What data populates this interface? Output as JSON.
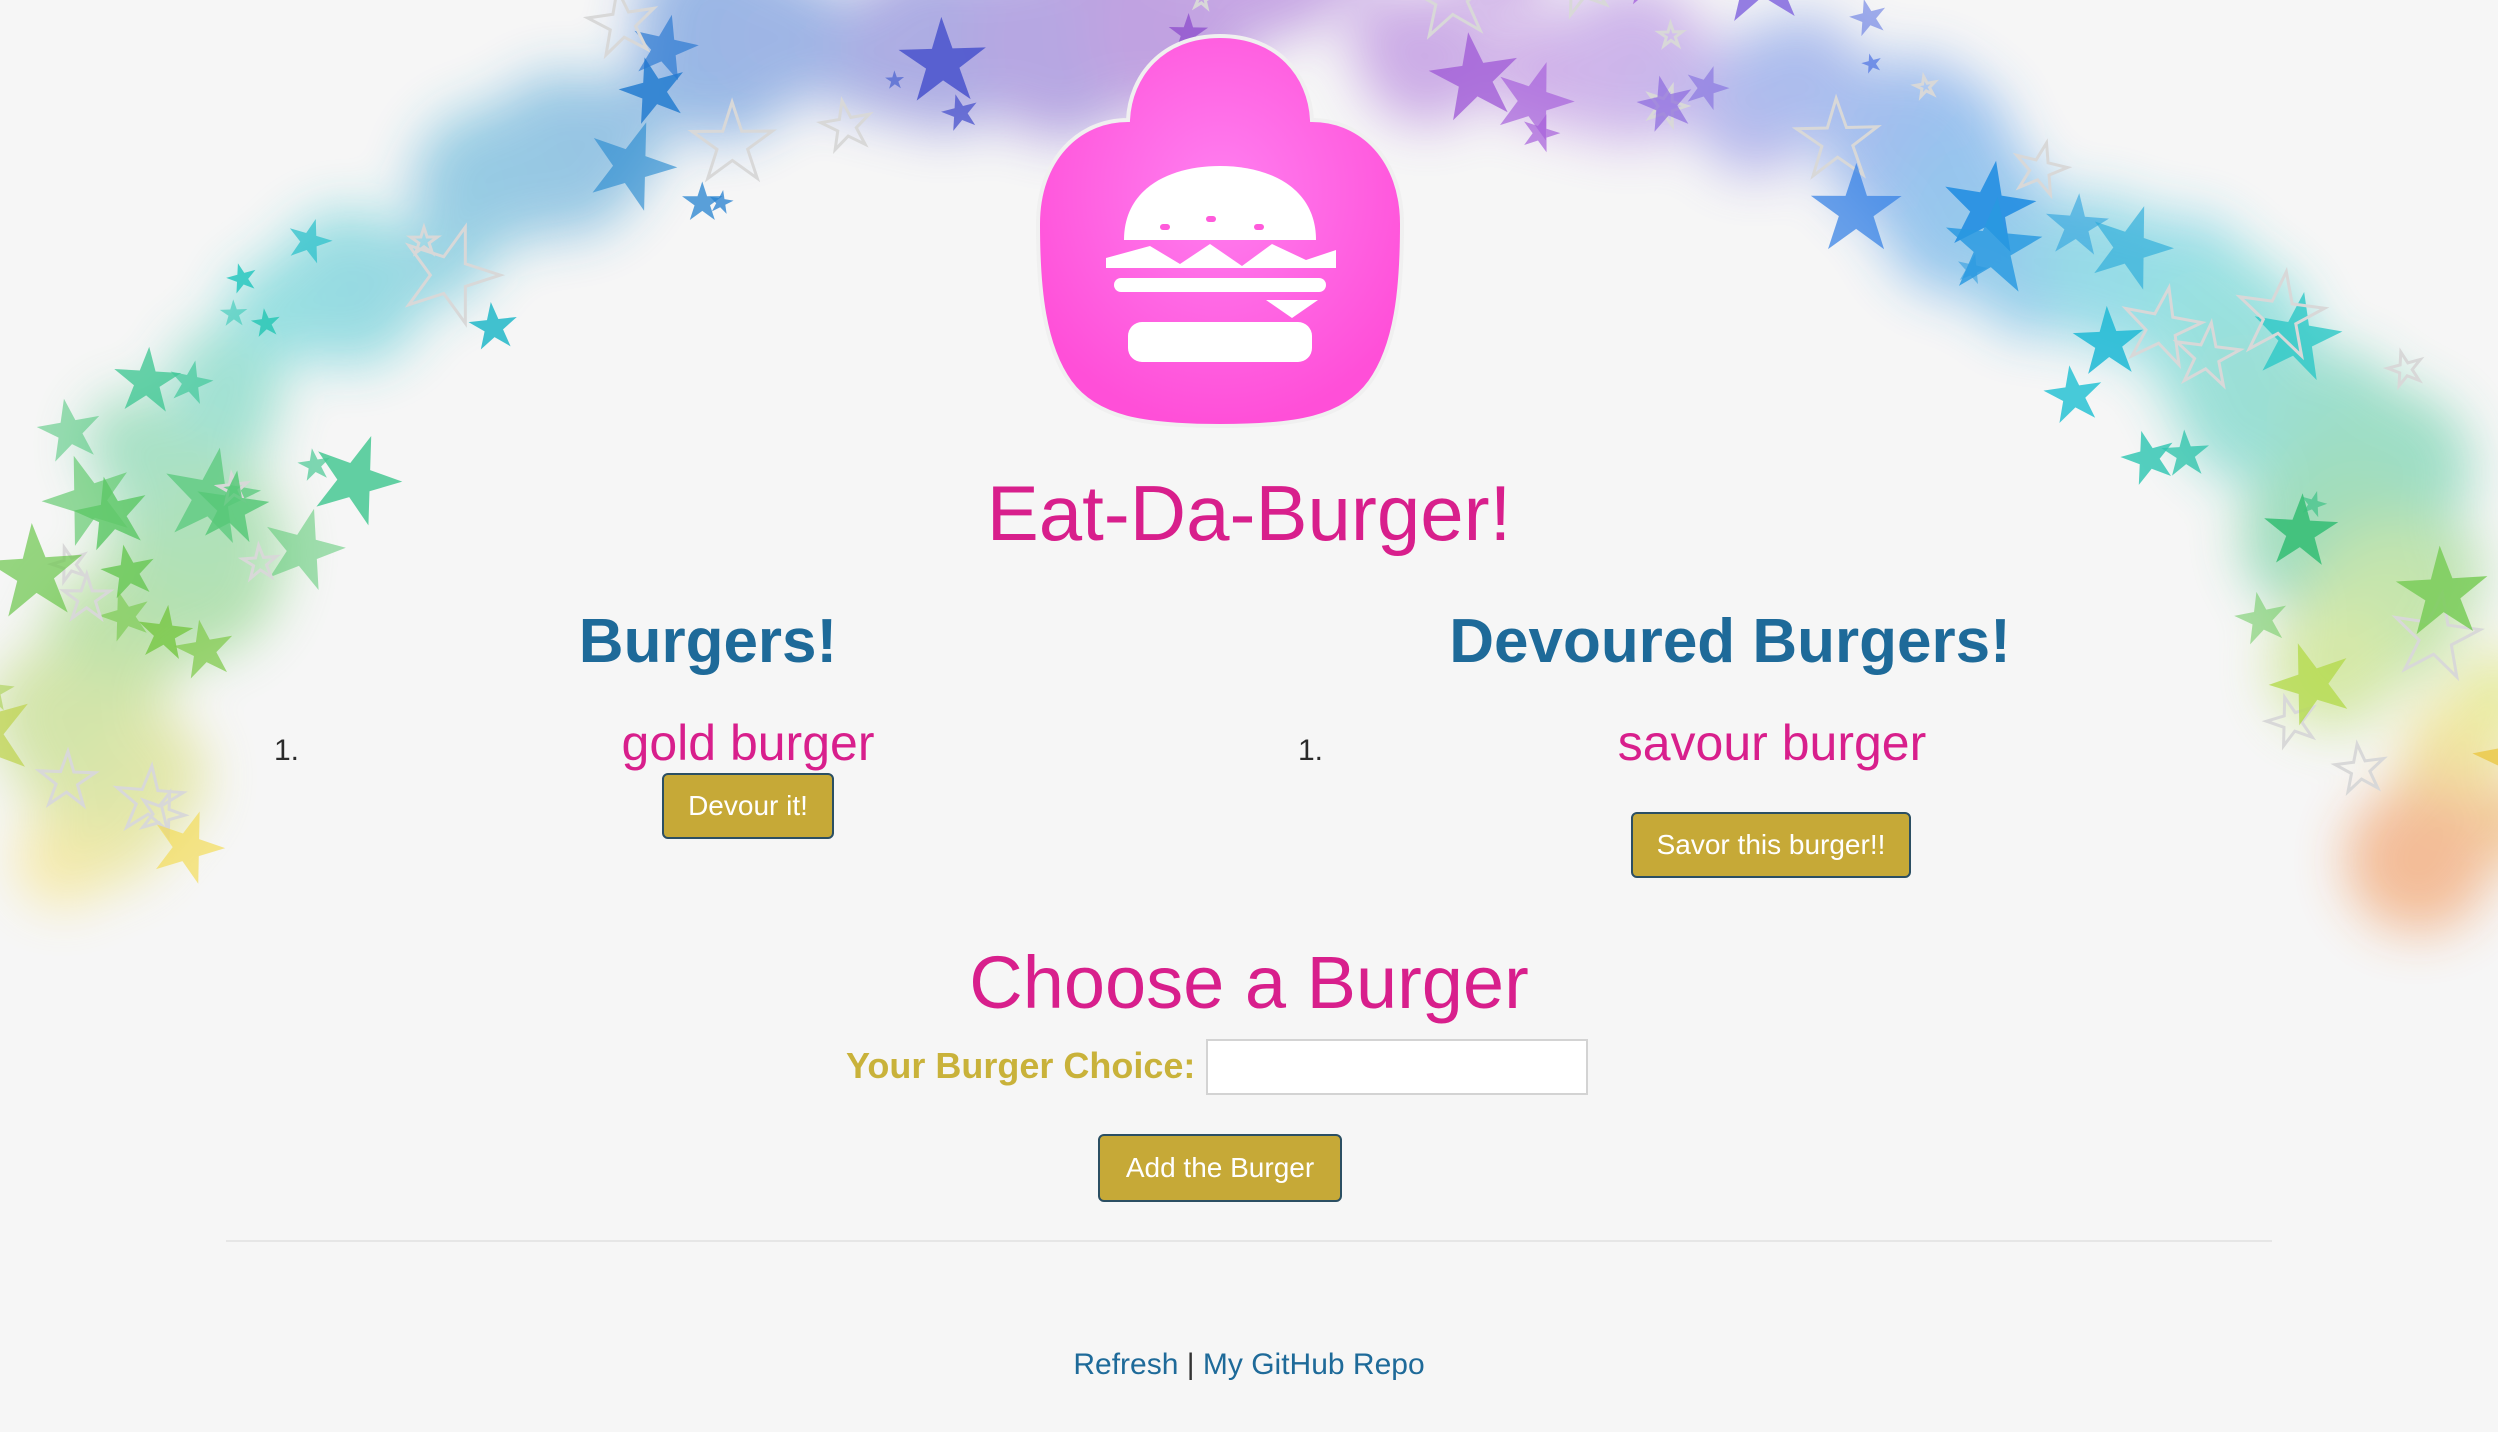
{
  "header": {
    "logo_icon": "burger-icon",
    "logo_color": "#ff66dd",
    "title": "Eat-Da-Burger!"
  },
  "burgers": {
    "heading": "Burgers!",
    "items": [
      {
        "number": "1.",
        "name": "gold burger",
        "button_label": "Devour it!"
      }
    ]
  },
  "devoured": {
    "heading": "Devoured Burgers!",
    "items": [
      {
        "number": "1.",
        "name": "savour burger",
        "button_label": "Savor this burger!!"
      }
    ]
  },
  "form": {
    "title": "Choose a Burger",
    "label": "Your Burger Choice:",
    "input_value": "",
    "placeholder": "",
    "submit_label": "Add the Burger"
  },
  "footer": {
    "refresh_label": "Refresh",
    "separator": "|",
    "repo_label": "My GitHub Repo"
  },
  "colors": {
    "title_pink": "#d81f8c",
    "heading_blue": "#1e6a99",
    "button_gold": "#c6a937",
    "label_gold": "#c9b23a",
    "background": "#f6f6f6"
  }
}
